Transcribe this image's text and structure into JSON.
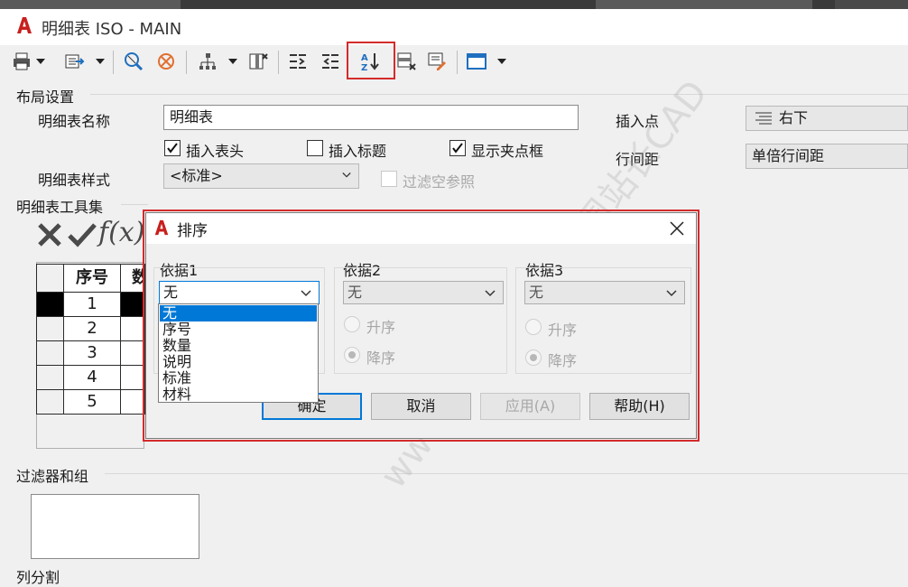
{
  "window": {
    "title": "明细表 ISO - MAIN"
  },
  "toolbar": {
    "icons": [
      "print-icon",
      "export-icon",
      "zoom-extents-icon",
      "zoom-off-icon",
      "structure-icon",
      "delete-column-icon",
      "indent-icon",
      "outdent-icon",
      "sort-az-icon",
      "delete-row-icon",
      "edit-note-icon",
      "window-layout-icon"
    ]
  },
  "layout": {
    "section_title": "布局设置",
    "name_label": "明细表名称",
    "name_value": "明细表",
    "insert_point_label": "插入点",
    "insert_point_value": "右下",
    "insert_header_label": "插入表头",
    "insert_title_label": "插入标题",
    "show_frame_label": "显示夹点框",
    "row_spacing_label": "行间距",
    "row_spacing_value": "单倍行间距",
    "style_label": "明细表样式",
    "style_value": "<标准>",
    "filter_empty_label": "过滤空参照"
  },
  "tools": {
    "section_title": "明细表工具集",
    "icons": [
      "cancel-icon",
      "confirm-icon",
      "formula-icon"
    ],
    "formula_text": "f(x)"
  },
  "grid": {
    "header": [
      "序号",
      "数"
    ],
    "rows": [
      "1",
      "2",
      "3",
      "4",
      "5"
    ]
  },
  "filter": {
    "section_title": "过滤器和组",
    "split_label": "列分割"
  },
  "dialog": {
    "title": "排序",
    "group1": {
      "title": "依据1",
      "value": "无"
    },
    "group2": {
      "title": "依据2",
      "value": "无",
      "asc": "升序",
      "desc": "降序"
    },
    "group3": {
      "title": "依据3",
      "value": "无",
      "asc": "升序",
      "desc": "降序"
    },
    "buttons": {
      "ok": "确定",
      "cancel": "取消",
      "apply": "应用(A)",
      "help": "帮助(H)"
    },
    "dropdown_options": [
      "无",
      "序号",
      "数量",
      "说明",
      "标准",
      "材料"
    ]
  },
  "watermark": "www.zzzcad.com  周站长CAD",
  "colors": {
    "highlight": "#d42b2b",
    "selection": "#0078d7",
    "app_red": "#c8201e"
  }
}
